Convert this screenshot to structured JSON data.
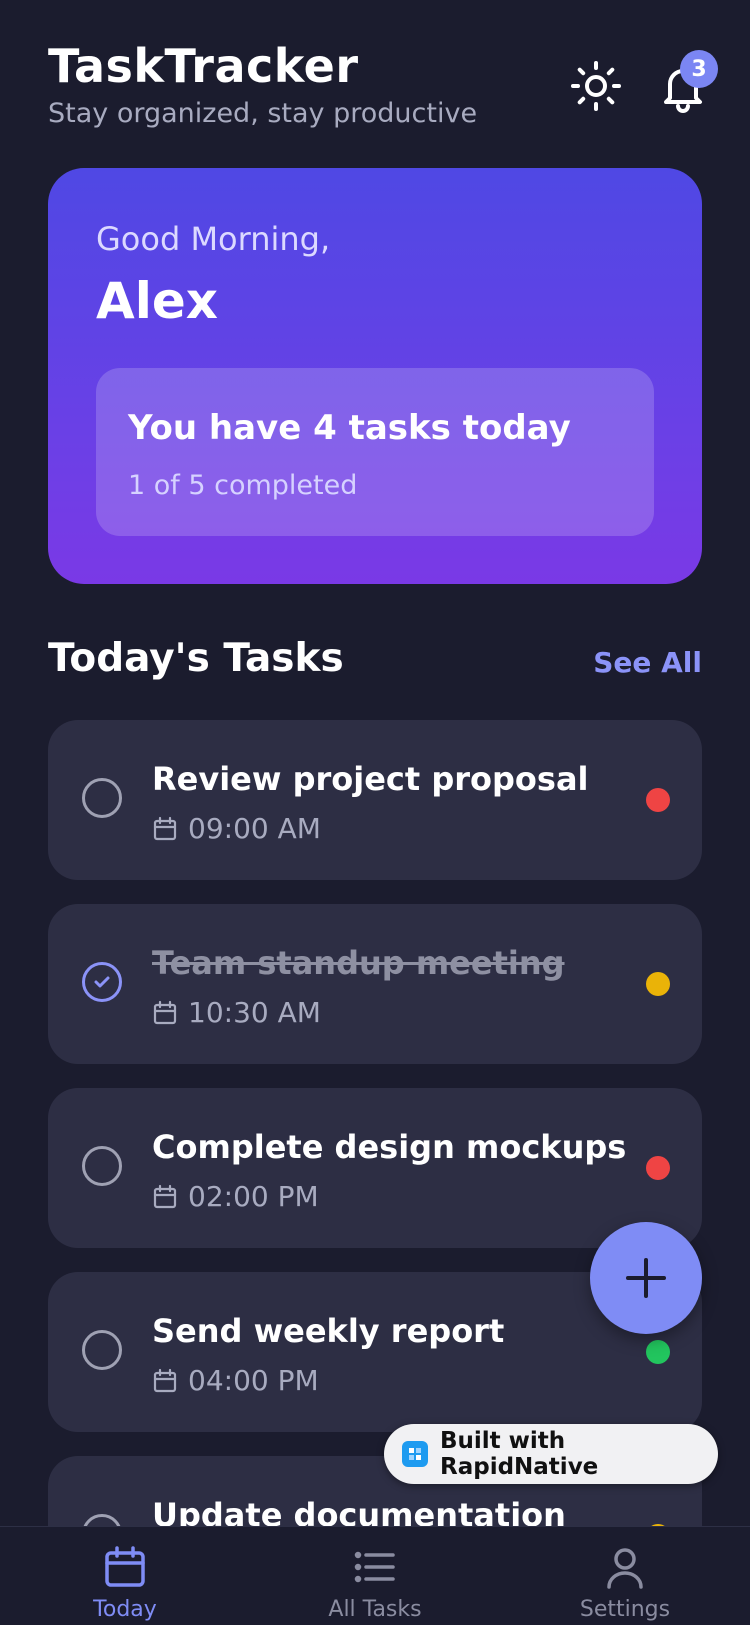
{
  "header": {
    "title": "TaskTracker",
    "subtitle": "Stay organized, stay productive",
    "notification_count": "3"
  },
  "hero": {
    "greeting": "Good Morning,",
    "name": "Alex",
    "summary_title": "You have 4 tasks today",
    "summary_sub": "1 of 5 completed"
  },
  "section": {
    "title": "Today's Tasks",
    "see_all": "See All"
  },
  "tasks": [
    {
      "title": "Review project proposal",
      "time": "09:00 AM",
      "completed": false,
      "priority_color": "#ef4444"
    },
    {
      "title": "Team standup meeting",
      "time": "10:30 AM",
      "completed": true,
      "priority_color": "#eab308"
    },
    {
      "title": "Complete design mockups",
      "time": "02:00 PM",
      "completed": false,
      "priority_color": "#ef4444"
    },
    {
      "title": "Send weekly report",
      "time": "04:00 PM",
      "completed": false,
      "priority_color": "#22c55e"
    },
    {
      "title": "Update documentation",
      "time": "",
      "completed": false,
      "priority_color": "#eab308"
    }
  ],
  "badge": {
    "label": "Built with RapidNative"
  },
  "tabbar": {
    "today": "Today",
    "all_tasks": "All Tasks",
    "settings": "Settings"
  },
  "colors": {
    "accent": "#7f8cf5",
    "background": "#1b1c2e",
    "card": "#2d2e44"
  }
}
